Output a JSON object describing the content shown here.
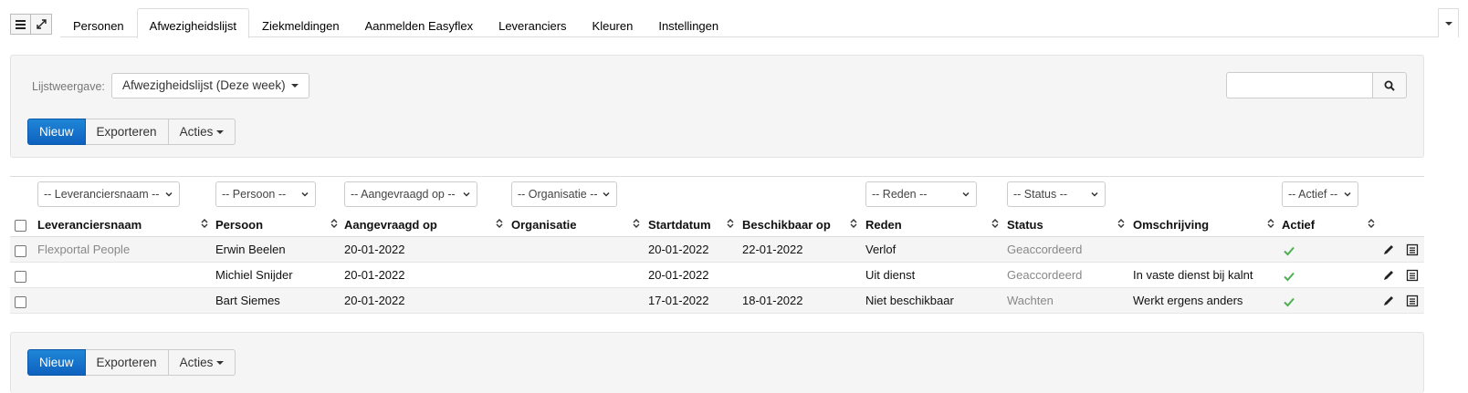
{
  "toolbar": {
    "list_icon": "list-icon",
    "collapse_icon": "collapse-arrows-icon"
  },
  "tabs": [
    {
      "label": "Personen",
      "active": false
    },
    {
      "label": "Afwezigheidslijst",
      "active": true
    },
    {
      "label": "Ziekmeldingen",
      "active": false
    },
    {
      "label": "Aanmelden Easyflex",
      "active": false
    },
    {
      "label": "Leveranciers",
      "active": false
    },
    {
      "label": "Kleuren",
      "active": false
    },
    {
      "label": "Instellingen",
      "active": false
    }
  ],
  "listview": {
    "label": "Lijstweergave:",
    "selected": "Afwezigheidslijst (Deze week)"
  },
  "search": {
    "placeholder": "",
    "icon": "search-icon"
  },
  "actions": {
    "new_label": "Nieuw",
    "export_label": "Exporteren",
    "actions_label": "Acties"
  },
  "filters": {
    "supplier": "-- Leveranciersnaam --",
    "person": "-- Persoon --",
    "requested": "-- Aangevraagd op --",
    "organisation": "-- Organisatie --",
    "reason": "-- Reden --",
    "status": "-- Status --",
    "active": "-- Actief --"
  },
  "columns": {
    "supplier": "Leveranciersnaam",
    "person": "Persoon",
    "requested": "Aangevraagd op",
    "organisation": "Organisatie",
    "start": "Startdatum",
    "available": "Beschikbaar op",
    "reason": "Reden",
    "status": "Status",
    "description": "Omschrijving",
    "active": "Actief"
  },
  "rows": [
    {
      "supplier": "Flexportal People",
      "person": "Erwin Beelen",
      "requested": "20-01-2022",
      "organisation": "",
      "start": "20-01-2022",
      "available": "22-01-2022",
      "reason": "Verlof",
      "status": "Geaccordeerd",
      "description": "",
      "active": true
    },
    {
      "supplier": "",
      "person": "Michiel Snijder",
      "requested": "20-01-2022",
      "organisation": "",
      "start": "20-01-2022",
      "available": "",
      "reason": "Uit dienst",
      "status": "Geaccordeerd",
      "description": "In vaste dienst bij kalnt",
      "active": true
    },
    {
      "supplier": "",
      "person": "Bart Siemes",
      "requested": "20-01-2022",
      "organisation": "",
      "start": "17-01-2022",
      "available": "18-01-2022",
      "reason": "Niet beschikbaar",
      "status": "Wachten",
      "description": "Werkt ergens anders",
      "active": true
    }
  ],
  "colors": {
    "primary": "#0e62bf",
    "active_check": "#4caf50",
    "muted_text": "#888888"
  }
}
